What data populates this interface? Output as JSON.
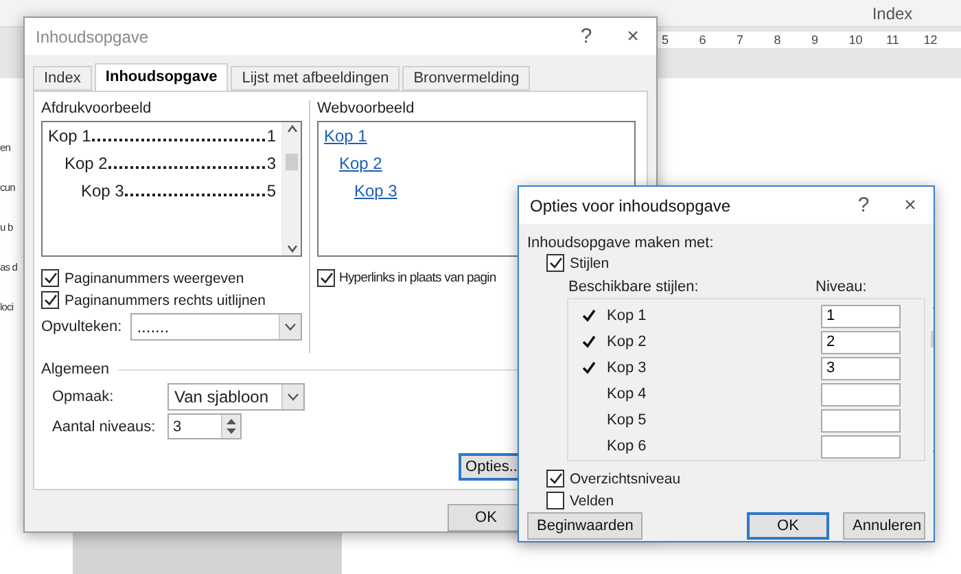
{
  "ribbon": {
    "groups": [
      "Index"
    ]
  },
  "ruler": {
    "ticks": [
      "5",
      "6",
      "7",
      "8",
      "9",
      "10",
      "11",
      "12"
    ]
  },
  "document": {
    "fragments": [
      "en",
      "cun",
      "u b",
      "as d",
      "loci"
    ]
  },
  "toc_dialog": {
    "title": "Inhoudsopgave",
    "help": "?",
    "close": "×",
    "tabs": [
      {
        "label": "Index",
        "selected": false
      },
      {
        "label": "Inhoudsopgave",
        "selected": true
      },
      {
        "label": "Lijst met afbeeldingen",
        "selected": false
      },
      {
        "label": "Bronvermelding",
        "selected": false
      }
    ],
    "print_preview": {
      "label": "Afdrukvoorbeeld",
      "entries": [
        {
          "text": "Kop 1",
          "page": "1"
        },
        {
          "text": "Kop 2",
          "page": "3"
        },
        {
          "text": "Kop 3",
          "page": "5"
        }
      ]
    },
    "show_page_numbers": {
      "label": "Paginanummers weergeven",
      "checked": true
    },
    "right_align": {
      "label": "Paginanummers rechts uitlijnen",
      "checked": true
    },
    "tab_leader": {
      "label": "Opvulteken:",
      "value": "......."
    },
    "web_preview": {
      "label": "Webvoorbeeld",
      "entries": [
        "Kop 1",
        "Kop 2",
        "Kop 3"
      ]
    },
    "hyperlinks": {
      "label": "Hyperlinks in plaats van pagin",
      "checked": true
    },
    "general": {
      "label": "Algemeen",
      "format": {
        "label": "Opmaak:",
        "value": "Van sjabloon"
      },
      "levels": {
        "label": "Aantal niveaus:",
        "value": "3"
      }
    },
    "options_button": "Opties..",
    "ok_button": "OK"
  },
  "options_dialog": {
    "title": "Opties voor inhoudsopgave",
    "help": "?",
    "close": "×",
    "build_from": "Inhoudsopgave maken met:",
    "styles_option": {
      "label": "Stijlen",
      "checked": true
    },
    "columns": [
      "Beschikbare stijlen:",
      "Niveau:"
    ],
    "styles": [
      {
        "name": "Kop 1",
        "checked": true,
        "assigned_level": "1"
      },
      {
        "name": "Kop 2",
        "checked": true,
        "assigned_level": "2"
      },
      {
        "name": "Kop 3",
        "checked": true,
        "assigned_level": "3"
      },
      {
        "name": "Kop 4",
        "checked": false
      },
      {
        "name": "Kop 5",
        "checked": false
      },
      {
        "name": "Kop 6",
        "checked": false
      }
    ],
    "outline": {
      "label": "Overzichtsniveau",
      "checked": true
    },
    "fields": {
      "label": "Velden",
      "checked": false
    },
    "buttons": [
      {
        "label": "Beginwaarden",
        "default": false
      },
      {
        "label": "OK",
        "default": true
      },
      {
        "label": "Annuleren",
        "default": false
      }
    ]
  }
}
